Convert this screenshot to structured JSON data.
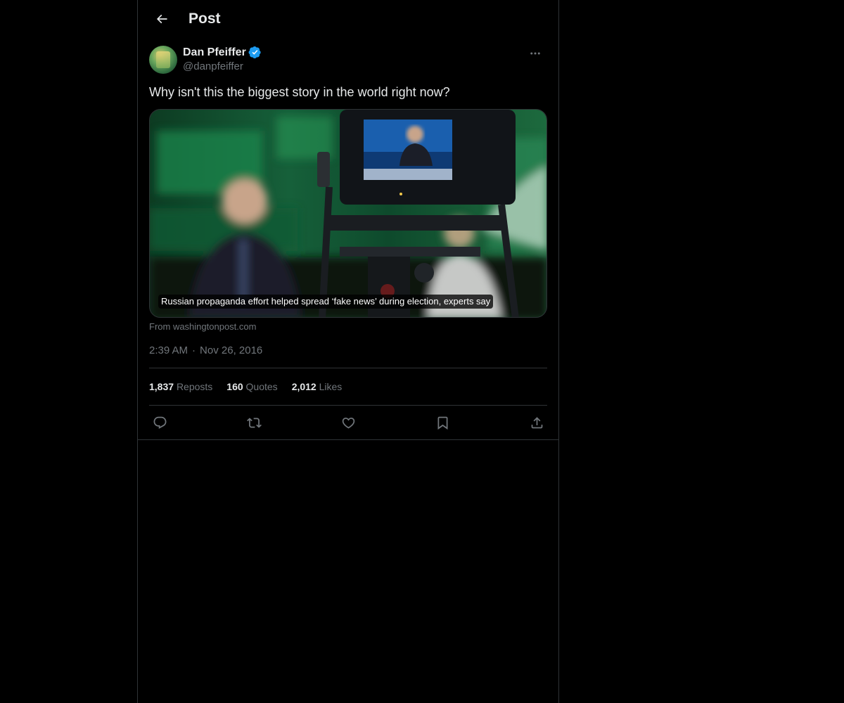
{
  "header": {
    "title": "Post"
  },
  "post": {
    "author": {
      "display_name": "Dan Pfeiffer",
      "handle": "@danpfeiffer",
      "verified": true
    },
    "text": "Why isn't this the biggest story in the world right now?",
    "card": {
      "caption": "Russian propaganda effort helped spread ‘fake news’ during election, experts say",
      "source": "From washingtonpost.com"
    },
    "time": "2:39 AM",
    "date": "Nov 26, 2016",
    "stats": [
      {
        "value": "1,837",
        "label": "Reposts"
      },
      {
        "value": "160",
        "label": "Quotes"
      },
      {
        "value": "2,012",
        "label": "Likes"
      }
    ]
  },
  "actions": [
    "reply-icon",
    "repost-icon",
    "like-icon",
    "bookmark-icon",
    "share-icon"
  ],
  "colors": {
    "background": "#000000",
    "border": "#2f3336",
    "muted": "#71767b",
    "text": "#e7e9ea",
    "verified": "#1d9bf0"
  }
}
